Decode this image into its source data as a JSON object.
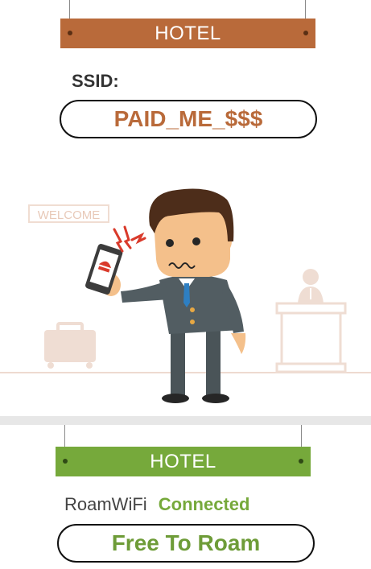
{
  "top": {
    "sign_text": "HOTEL",
    "ssid_label": "SSID:",
    "ssid_value": "PAID_ME_$$$"
  },
  "scene": {
    "welcome_sign": "WELCOME"
  },
  "bottom": {
    "sign_text": "HOTEL",
    "network_name": "RoamWiFi",
    "status": "Connected",
    "slogan": "Free To Roam"
  },
  "colors": {
    "brown": "#b96a3a",
    "green": "#76a93b",
    "text_dark": "#333333"
  }
}
